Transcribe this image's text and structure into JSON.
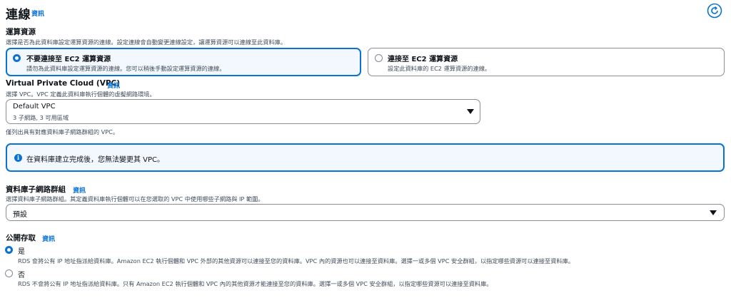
{
  "header": {
    "title": "連線",
    "info": "資訊",
    "refresh_icon": "refresh-icon"
  },
  "compute": {
    "label": "運算資源",
    "description": "選擇是否為此資料庫設定運算資源的連線。設定連線會自動變更連線設定，讓運算資源可以連線至此資料庫。",
    "options": [
      {
        "title": "不要連接至 EC2 運算資源",
        "description": "請勿為此資料庫設定運算資源的連線。您可以稍後手動設定運算資源的連線。",
        "selected": true
      },
      {
        "title": "連接至 EC2 運算資源",
        "description": "設定此資料庫的 EC2 運算資源的連線。",
        "selected": false
      }
    ]
  },
  "vpc": {
    "label": "Virtual Private Cloud (VPC)",
    "info": "資訊",
    "description": "選擇 VPC。VPC 定義此資料庫執行個體的虛擬網路環境。",
    "selected_name": "Default VPC",
    "selected_detail": "3 子網路, 3 可用區域",
    "hint": "僅列出具有對應資料庫子網路群組的 VPC。"
  },
  "alert": {
    "icon": "info-circle-icon",
    "text": "在資料庫建立完成後，您無法變更其 VPC。",
    "accent": "#0972d3"
  },
  "subnet_group": {
    "label": "資料庫子網路群組",
    "info": "資訊",
    "description": "選擇資料庫子網路群組。其定義資料庫執行個體可以在您選取的 VPC 中使用哪些子網路與 IP 範圍。",
    "selected": "預設"
  },
  "public_access": {
    "label": "公開存取",
    "info": "資訊",
    "options": [
      {
        "label": "是",
        "description": "RDS 會將公有 IP 地址指派給資料庫。Amazon EC2 執行個體和 VPC 外部的其他資源可以連接至您的資料庫。VPC 內的資源也可以連接至資料庫。選擇一或多個 VPC 安全群組，以指定哪些資源可以連接至資料庫。",
        "selected": true
      },
      {
        "label": "否",
        "description": "RDS 不會將公有 IP 地址指派給資料庫。只有 Amazon EC2 執行個體和 VPC 內的其他資源才能連接至您的資料庫。選擇一或多個 VPC 安全群組，以指定哪些資源可以連接至資料庫。",
        "selected": false
      }
    ]
  }
}
